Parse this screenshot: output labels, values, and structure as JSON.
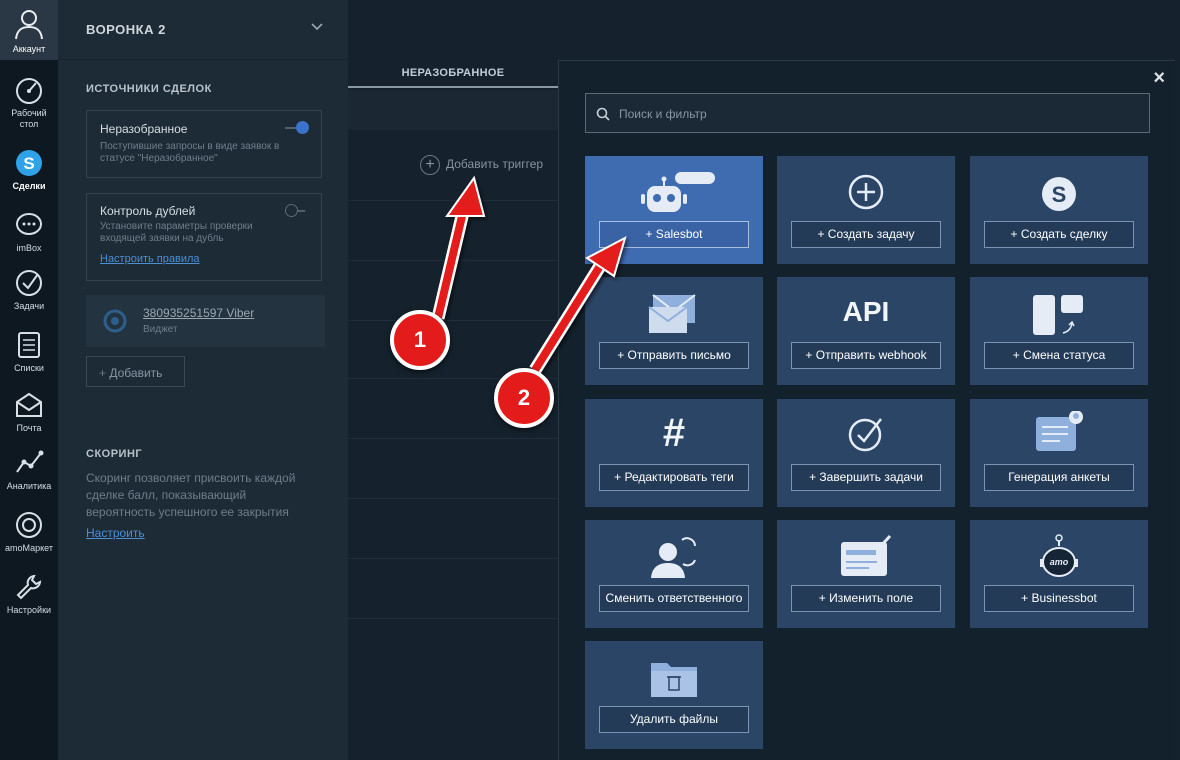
{
  "nav": {
    "account_label": "Аккаунт",
    "items": [
      {
        "label": "Рабочий стол",
        "icon": "dashboard-icon"
      },
      {
        "label": "Сделки",
        "icon": "deals-icon"
      },
      {
        "label": "imBox",
        "icon": "chat-icon"
      },
      {
        "label": "Задачи",
        "icon": "tasks-icon"
      },
      {
        "label": "Списки",
        "icon": "lists-icon"
      },
      {
        "label": "Почта",
        "icon": "mail-icon"
      },
      {
        "label": "Аналитика",
        "icon": "analytics-icon"
      },
      {
        "label": "amoМаркет",
        "icon": "market-icon"
      },
      {
        "label": "Настройки",
        "icon": "settings-icon"
      }
    ],
    "active_index": 1
  },
  "pipeline": {
    "title": "ВОРОНКА 2"
  },
  "sources": {
    "title": "ИСТОЧНИКИ СДЕЛОК",
    "unsorted": {
      "name": "Неразобранное",
      "desc": "Поступившие запросы в виде заявок в статусе \"Неразобранное\"",
      "enabled": true
    },
    "duplicates": {
      "name": "Контроль дублей",
      "desc": "Установите параметры проверки входящей заявки на дубль",
      "link": "Настроить правила",
      "enabled": false
    },
    "viber": {
      "number": "380935251597 Viber",
      "sub": "Виджет"
    },
    "add_label": "Добавить"
  },
  "scoring": {
    "title": "СКОРИНГ",
    "text": "Скоринг позволяет присвоить каждой сделке балл, показывающий вероятность успешного ее закрытия",
    "link": "Настроить"
  },
  "stage": {
    "tab_label": "НЕРАЗОБРАННОЕ",
    "add_trigger": "Добавить триггер"
  },
  "modal": {
    "close": "×",
    "search_placeholder": "Поиск и фильтр",
    "tiles": [
      {
        "label": "+ Salesbot",
        "icon": "robot-icon",
        "highlighted": true
      },
      {
        "label": "+ Создать задачу",
        "icon": "plus-circle-icon"
      },
      {
        "label": "+ Создать сделку",
        "icon": "deal-coin-icon"
      },
      {
        "label": "+ Отправить письмо",
        "icon": "envelope-icon"
      },
      {
        "label": "+ Отправить webhook",
        "icon": "api-icon",
        "icon_text": "API"
      },
      {
        "label": "+ Смена статуса",
        "icon": "status-change-icon"
      },
      {
        "label": "+ Редактировать теги",
        "icon": "hashtag-icon"
      },
      {
        "label": "+ Завершить задачи",
        "icon": "check-circle-icon"
      },
      {
        "label": "Генерация анкеты",
        "icon": "form-generate-icon"
      },
      {
        "label": "Сменить ответственного",
        "icon": "change-responsible-icon"
      },
      {
        "label": "+ Изменить поле",
        "icon": "edit-field-icon"
      },
      {
        "label": "+ Businessbot",
        "icon": "businessbot-icon",
        "icon_text": "amo"
      },
      {
        "label": "Удалить файлы",
        "icon": "delete-files-icon"
      }
    ]
  },
  "annotations": {
    "badge1": "1",
    "badge2": "2",
    "arrow_color": "#e41b1b"
  }
}
